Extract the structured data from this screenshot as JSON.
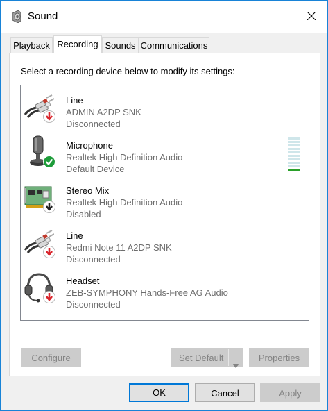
{
  "window": {
    "title": "Sound",
    "icon": "speaker-icon",
    "close_icon": "close-icon"
  },
  "tabs": [
    {
      "label": "Playback"
    },
    {
      "label": "Recording"
    },
    {
      "label": "Sounds"
    },
    {
      "label": "Communications"
    }
  ],
  "active_tab": "Recording",
  "instruction": "Select a recording device below to modify its settings:",
  "devices": [
    {
      "name": "Line",
      "description": "ADMIN A2DP SNK",
      "status": "Disconnected",
      "icon": "line-in-cable-icon",
      "badge": "red-down-arrow-icon"
    },
    {
      "name": "Microphone",
      "description": "Realtek High Definition Audio",
      "status": "Default Device",
      "icon": "microphone-icon",
      "badge": "green-check-icon"
    },
    {
      "name": "Stereo Mix",
      "description": "Realtek High Definition Audio",
      "status": "Disabled",
      "icon": "sound-card-icon",
      "badge": "black-down-arrow-icon"
    },
    {
      "name": "Line",
      "description": "Redmi Note 11 A2DP SNK",
      "status": "Disconnected",
      "icon": "line-in-cable-icon",
      "badge": "red-down-arrow-icon"
    },
    {
      "name": "Headset",
      "description": "ZEB-SYMPHONY Hands-Free AG Audio",
      "status": "Disconnected",
      "icon": "headset-icon",
      "badge": "red-down-arrow-icon"
    }
  ],
  "level_meter": {
    "level_fraction": 0.1,
    "active_color": "#2aa02a",
    "inactive_color": "#cfe6ea"
  },
  "panel_buttons": {
    "configure": "Configure",
    "set_default": "Set Default",
    "properties": "Properties"
  },
  "footer_buttons": {
    "ok": "OK",
    "cancel": "Cancel",
    "apply": "Apply"
  },
  "colors": {
    "accent": "#0078d7",
    "window_border": "#1883d7",
    "disconnected_badge": "#d9262d",
    "default_badge": "#1e9c3a"
  }
}
